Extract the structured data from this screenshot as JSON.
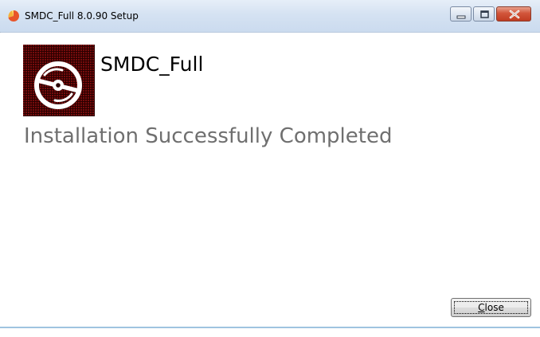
{
  "window": {
    "title": "SMDC_Full 8.0.90 Setup",
    "icon": "setup-app-icon",
    "controls": {
      "minimize_icon": "minimize-icon",
      "maximize_icon": "maximize-icon",
      "close_icon": "close-icon"
    }
  },
  "header": {
    "product_name": "SMDC_Full",
    "logo_icon": "disc-icon"
  },
  "main": {
    "status": "Installation Successfully Completed"
  },
  "footer": {
    "close_button": {
      "label_accelerator": "C",
      "label_rest": "lose"
    }
  },
  "colors": {
    "status_text": "#6f6f6f",
    "logo_background": "#2a0000",
    "close_control": "#c03c22"
  }
}
